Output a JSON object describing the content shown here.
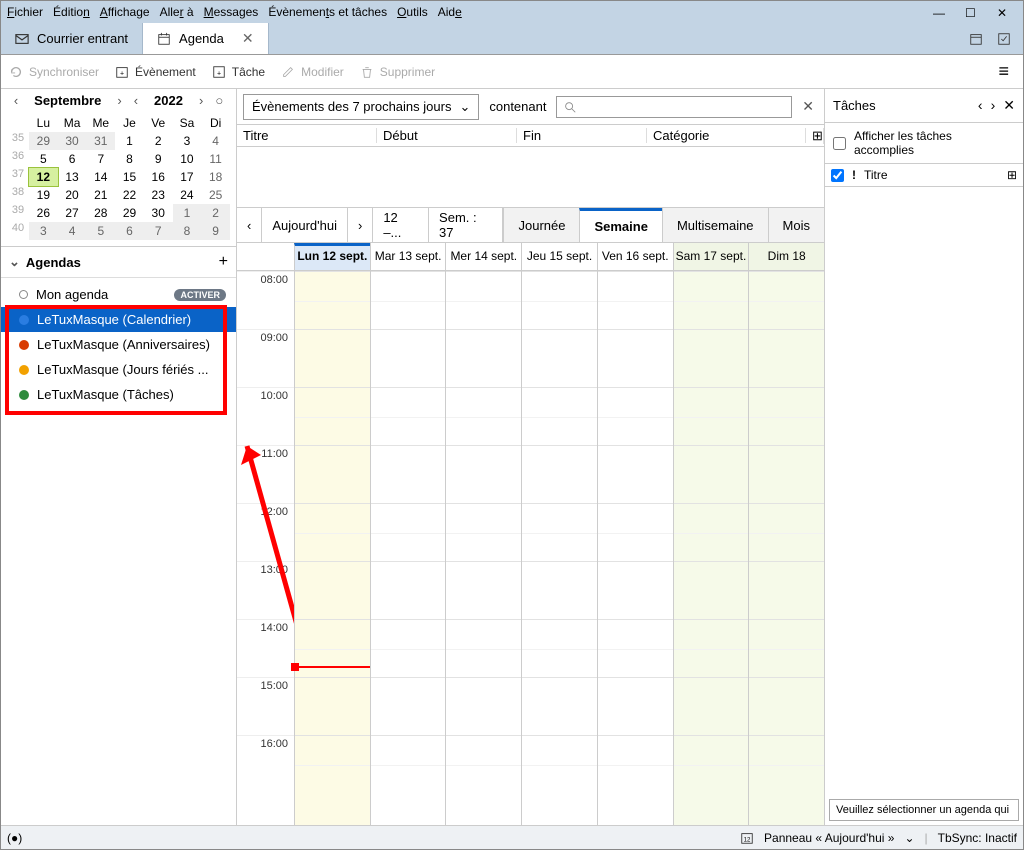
{
  "menu": {
    "items": [
      "Fichier",
      "Édition",
      "Affichage",
      "Aller à",
      "Messages",
      "Évènements et tâches",
      "Outils",
      "Aide"
    ]
  },
  "tabs": {
    "mail": "Courrier entrant",
    "agenda": "Agenda"
  },
  "toolbar": {
    "sync": "Synchroniser",
    "event": "Évènement",
    "task": "Tâche",
    "edit": "Modifier",
    "delete": "Supprimer"
  },
  "calendarNav": {
    "month": "Septembre",
    "year": "2022"
  },
  "dayHeaders": [
    "Lu",
    "Ma",
    "Me",
    "Je",
    "Ve",
    "Sa",
    "Di"
  ],
  "weekNums": [
    "35",
    "36",
    "37",
    "38",
    "39",
    "40"
  ],
  "calCells": [
    [
      {
        "n": "29",
        "cls": "prev"
      },
      {
        "n": "30",
        "cls": "prev"
      },
      {
        "n": "31",
        "cls": "prev"
      },
      {
        "n": "1"
      },
      {
        "n": "2"
      },
      {
        "n": "3"
      },
      {
        "n": "4",
        "cls": "sun"
      }
    ],
    [
      {
        "n": "5"
      },
      {
        "n": "6"
      },
      {
        "n": "7"
      },
      {
        "n": "8"
      },
      {
        "n": "9"
      },
      {
        "n": "10"
      },
      {
        "n": "11",
        "cls": "sun"
      }
    ],
    [
      {
        "n": "12",
        "cls": "today"
      },
      {
        "n": "13"
      },
      {
        "n": "14"
      },
      {
        "n": "15"
      },
      {
        "n": "16"
      },
      {
        "n": "17"
      },
      {
        "n": "18",
        "cls": "sun"
      }
    ],
    [
      {
        "n": "19"
      },
      {
        "n": "20"
      },
      {
        "n": "21"
      },
      {
        "n": "22"
      },
      {
        "n": "23"
      },
      {
        "n": "24"
      },
      {
        "n": "25",
        "cls": "sun"
      }
    ],
    [
      {
        "n": "26"
      },
      {
        "n": "27"
      },
      {
        "n": "28"
      },
      {
        "n": "29"
      },
      {
        "n": "30"
      },
      {
        "n": "1",
        "cls": "prev"
      },
      {
        "n": "2",
        "cls": "prev sun"
      }
    ],
    [
      {
        "n": "3",
        "cls": "prev"
      },
      {
        "n": "4",
        "cls": "prev"
      },
      {
        "n": "5",
        "cls": "prev"
      },
      {
        "n": "6",
        "cls": "prev"
      },
      {
        "n": "7",
        "cls": "prev"
      },
      {
        "n": "8",
        "cls": "prev"
      },
      {
        "n": "9",
        "cls": "prev sun"
      }
    ]
  ],
  "agendas": {
    "title": "Agendas",
    "items": [
      {
        "label": "Mon agenda",
        "color": "hollow",
        "activate": "ACTIVER"
      },
      {
        "label": "LeTuxMasque (Calendrier)",
        "color": "#2a7de1",
        "selected": true
      },
      {
        "label": "LeTuxMasque (Anniversaires)",
        "color": "#d83b01"
      },
      {
        "label": "LeTuxMasque (Jours fériés ...",
        "color": "#f2a100"
      },
      {
        "label": "LeTuxMasque (Tâches)",
        "color": "#2e8b3d"
      }
    ]
  },
  "filter": {
    "dropdown": "Évènements des 7 prochains jours",
    "contain": "contenant",
    "placeholder": ""
  },
  "eventCols": {
    "title": "Titre",
    "start": "Début",
    "end": "Fin",
    "cat": "Catégorie"
  },
  "viewbar": {
    "today": "Aujourd'hui",
    "range": "12 –...",
    "week": "Sem. : 37",
    "day": "Journée",
    "weekv": "Semaine",
    "multi": "Multisemaine",
    "month": "Mois"
  },
  "weekDays": [
    "Lun 12 sept.",
    "Mar 13 sept.",
    "Mer 14 sept.",
    "Jeu 15 sept.",
    "Ven 16 sept.",
    "Sam 17 sept.",
    "Dim 18"
  ],
  "hours": [
    "08:00",
    "09:00",
    "10:00",
    "11:00",
    "12:00",
    "13:00",
    "14:00",
    "15:00",
    "16:00"
  ],
  "tasks": {
    "title": "Tâches",
    "showDone": "Afficher les tâches accomplies",
    "colTitle": "Titre",
    "tip": "Veuillez sélectionner un agenda qui"
  },
  "status": {
    "panel": "Panneau « Aujourd'hui »",
    "sync": "TbSync: Inactif"
  }
}
